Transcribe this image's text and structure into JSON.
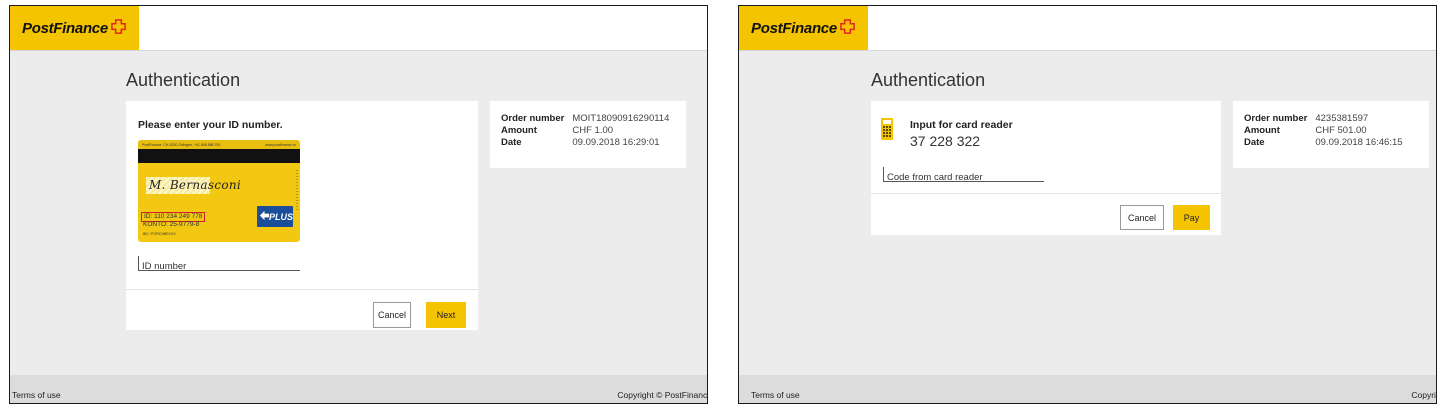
{
  "brand": {
    "name": "PostFinance",
    "color": "#f5c400",
    "logo_icon": "swiss-cross-icon"
  },
  "left": {
    "page_title": "Authentication",
    "card": {
      "heading": "Please enter your ID number.",
      "id_card": {
        "header_left": "PostFinance, CH-3030 Zofingen, +41 848 888 700",
        "header_right": "www.postfinance.ch",
        "signature": "M. Bernasconi",
        "id_line": "ID: 110 234 249 778",
        "konto_line": "KONTO: 25-9779-8",
        "small_line": "BIC: POFICHBEXXX",
        "plus_label": "PLUS"
      },
      "field_placeholder": "ID number",
      "cancel_label": "Cancel",
      "next_label": "Next"
    },
    "info": {
      "order_number_label": "Order number",
      "order_number": "MOIT18090916290114",
      "amount_label": "Amount",
      "amount": "CHF  1.00",
      "date_label": "Date",
      "date": "09.09.2018 16:29:01"
    },
    "footer": {
      "terms": "Terms of use",
      "copyright": "Copyright © PostFinance"
    }
  },
  "right": {
    "page_title": "Authentication",
    "card": {
      "heading": "Input for card reader",
      "code": "37 228 322",
      "card_reader_icon": "card-reader-icon",
      "field_placeholder": "Code from card reader",
      "cancel_label": "Cancel",
      "pay_label": "Pay"
    },
    "info": {
      "order_number_label": "Order number",
      "order_number": "4235381597",
      "amount_label": "Amount",
      "amount": "CHF 501.00",
      "date_label": "Date",
      "date": "09.09.2018 16:46:15"
    },
    "footer": {
      "terms": "Terms of use",
      "copyright": "Copyright © PostFinance"
    }
  }
}
